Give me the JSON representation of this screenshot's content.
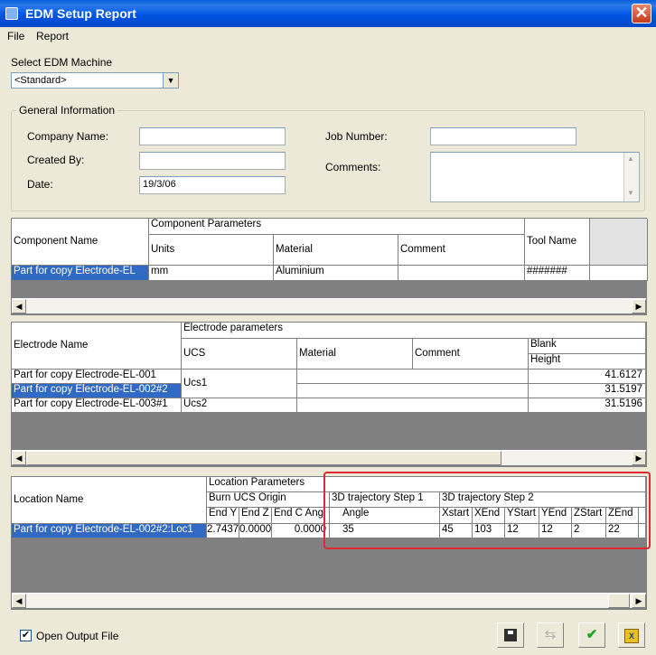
{
  "window": {
    "title": "EDM Setup Report",
    "close_glyph": "✕"
  },
  "menu": [
    "File",
    "Report"
  ],
  "machine": {
    "label": "Select EDM Machine",
    "value": "<Standard>"
  },
  "general": {
    "title": "General Information",
    "company_label": "Company Name:",
    "company_value": "",
    "created_label": "Created By:",
    "created_value": "",
    "date_label": "Date:",
    "date_value": "19/3/06",
    "job_label": "Job Number:",
    "job_value": "",
    "comments_label": "Comments:",
    "comments_value": ""
  },
  "component_table": {
    "col_name": "Component Name",
    "group": "Component Parameters",
    "col_units": "Units",
    "col_material": "Material",
    "col_comment": "Comment",
    "col_tool": "Tool Name",
    "rows": [
      {
        "name": "Part for copy Electrode-EL",
        "units": "mm",
        "material": "Aluminium",
        "comment": "",
        "tool": "#######"
      }
    ]
  },
  "electrode_table": {
    "col_name": "Electrode Name",
    "group": "Electrode parameters",
    "col_ucs": "UCS",
    "col_material": "Material",
    "col_comment": "Comment",
    "col_blank": "Blank",
    "col_height": "Height",
    "rows": [
      {
        "name": "Part for copy Electrode-EL-001",
        "height": "41.6127"
      },
      {
        "name": "Part for copy Electrode-EL-002#2",
        "height": "31.5197"
      },
      {
        "name": "Part for copy Electrode-EL-003#1",
        "height": "31.5196"
      }
    ],
    "ucs_values": [
      "Ucs1",
      "Ucs2"
    ]
  },
  "location_table": {
    "col_name": "Location Name",
    "group": "Location Parameters",
    "sub_group": "Burn UCS Origin",
    "step1": "3D trajectory Step 1",
    "step2": "3D trajectory Step 2",
    "cols": [
      "End Y",
      "End Z",
      "End C Angl",
      "Angle",
      "Xstart",
      "XEnd",
      "YStart",
      "YEnd",
      "ZStart",
      "ZEnd"
    ],
    "row": {
      "name": "Part for copy Electrode-EL-002#2:Loc1",
      "end_y": "2.7437",
      "end_z": "0.0000",
      "end_c": "0.0000",
      "angle": "35",
      "xstart": "45",
      "xend": "103",
      "ystart": "12",
      "yend": "12",
      "zstart": "2",
      "zend": "22"
    }
  },
  "footer": {
    "open_output_label": "Open Output File",
    "open_output_checked": true
  },
  "icons": [
    "save-icon",
    "export-icon",
    "check-icon",
    "excel-icon"
  ],
  "colors": {
    "selection": "#316AC5",
    "highlight": "#E0282E",
    "title_bar": "#0054E3"
  }
}
